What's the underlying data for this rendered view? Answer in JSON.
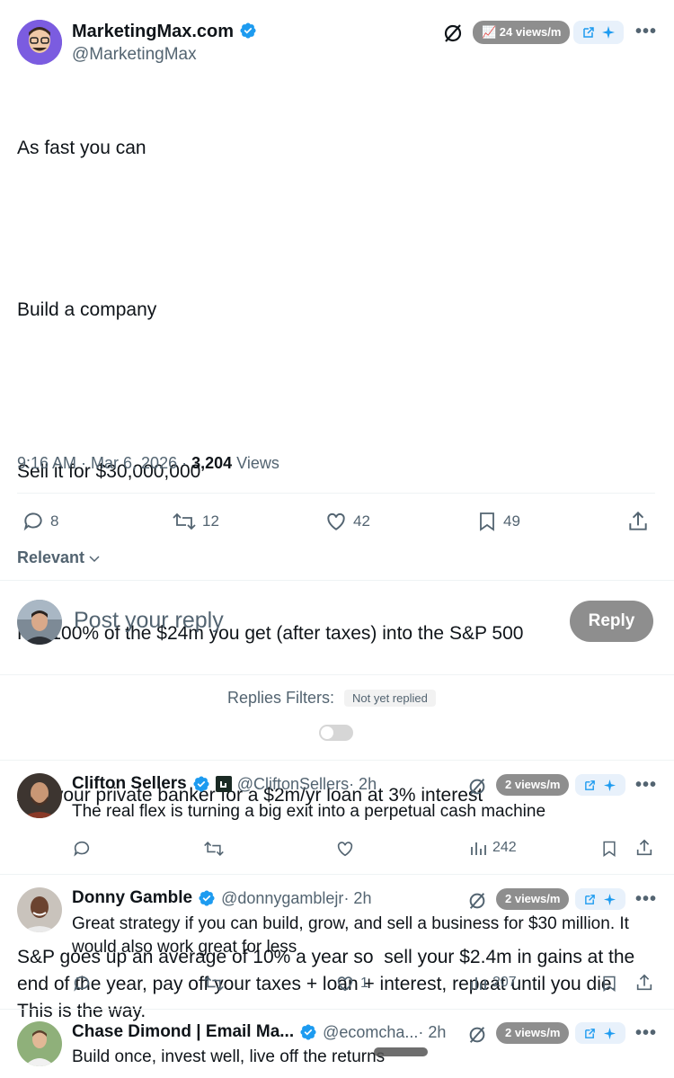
{
  "tweet": {
    "author_name": "MarketingMax.com",
    "author_handle": "@MarketingMax",
    "views_badge": "📈 24 views/m",
    "lines": [
      "As fast you can",
      "Build a company",
      "Sell it for $30,000,000",
      "Put 100% of the $24m you get (after taxes) into the S&P 500",
      "Ask your private banker for a $2m/yr loan at 3% interest",
      "S&P goes up an average of 10% a year so  sell your $2.4m in gains at the end of the year, pay off your taxes + loan + interest, repeat until you die. This is the way."
    ],
    "timestamp": "9:16 AM · Mar 6, 2026 · ",
    "views_count": "3,204",
    "views_label": " Views",
    "replies": "8",
    "reposts": "12",
    "likes": "42",
    "bookmarks": "49"
  },
  "sort": {
    "label": "Relevant"
  },
  "compose": {
    "placeholder": "Post your reply",
    "button": "Reply"
  },
  "filters": {
    "label": "Replies Filters:",
    "chip": "Not yet replied"
  },
  "replies": [
    {
      "name": "Clifton Sellers",
      "handle": "@CliftonSellers",
      "time": " · 2h",
      "views_badge": "2 views/m",
      "text": "The real flex is turning a big exit into a perpetual cash machine",
      "likes": "",
      "views": "242"
    },
    {
      "name": "Donny Gamble",
      "handle": "@donnygamblejr",
      "time": " · 2h",
      "views_badge": "2 views/m",
      "text": "Great strategy if you can build, grow, and sell a business for $30 million. It would also work great for less",
      "likes": "1",
      "views": "207"
    },
    {
      "name": "Chase Dimond | Email Ma...",
      "handle": "@ecomcha...",
      "time": " · 2h",
      "views_badge": "2 views/m",
      "text": "Build once, invest well, live off the returns",
      "likes": "",
      "views": ""
    }
  ],
  "colors": {
    "verified": "#1d9bf0",
    "text": "#0f1419",
    "muted": "#536471",
    "pill": "#8e8e8e"
  }
}
